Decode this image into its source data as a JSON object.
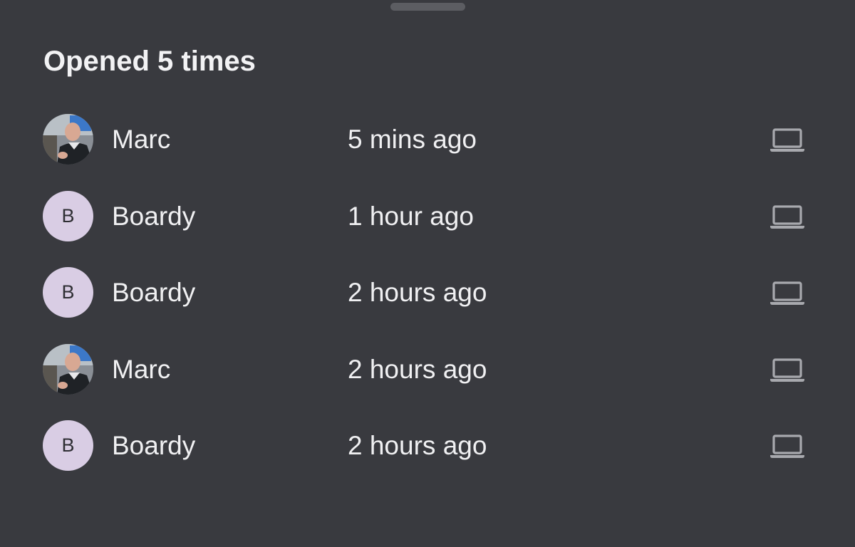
{
  "sheet": {
    "title": "Opened 5 times"
  },
  "opens": [
    {
      "viewer": "Marc",
      "avatar_type": "photo",
      "avatar_letter": "",
      "time": "5 mins ago",
      "device_icon": "laptop-icon"
    },
    {
      "viewer": "Boardy",
      "avatar_type": "letter",
      "avatar_letter": "B",
      "time": "1 hour ago",
      "device_icon": "laptop-icon"
    },
    {
      "viewer": "Boardy",
      "avatar_type": "letter",
      "avatar_letter": "B",
      "time": "2 hours ago",
      "device_icon": "laptop-icon"
    },
    {
      "viewer": "Marc",
      "avatar_type": "photo",
      "avatar_letter": "",
      "time": "2 hours ago",
      "device_icon": "laptop-icon"
    },
    {
      "viewer": "Boardy",
      "avatar_type": "letter",
      "avatar_letter": "B",
      "time": "2 hours ago",
      "device_icon": "laptop-icon"
    }
  ],
  "colors": {
    "background": "#393a3f",
    "text": "#f0f0f2",
    "letter_avatar_bg": "#d9cde4",
    "icon": "#a8a9ae",
    "grabber": "#5c5d62"
  }
}
